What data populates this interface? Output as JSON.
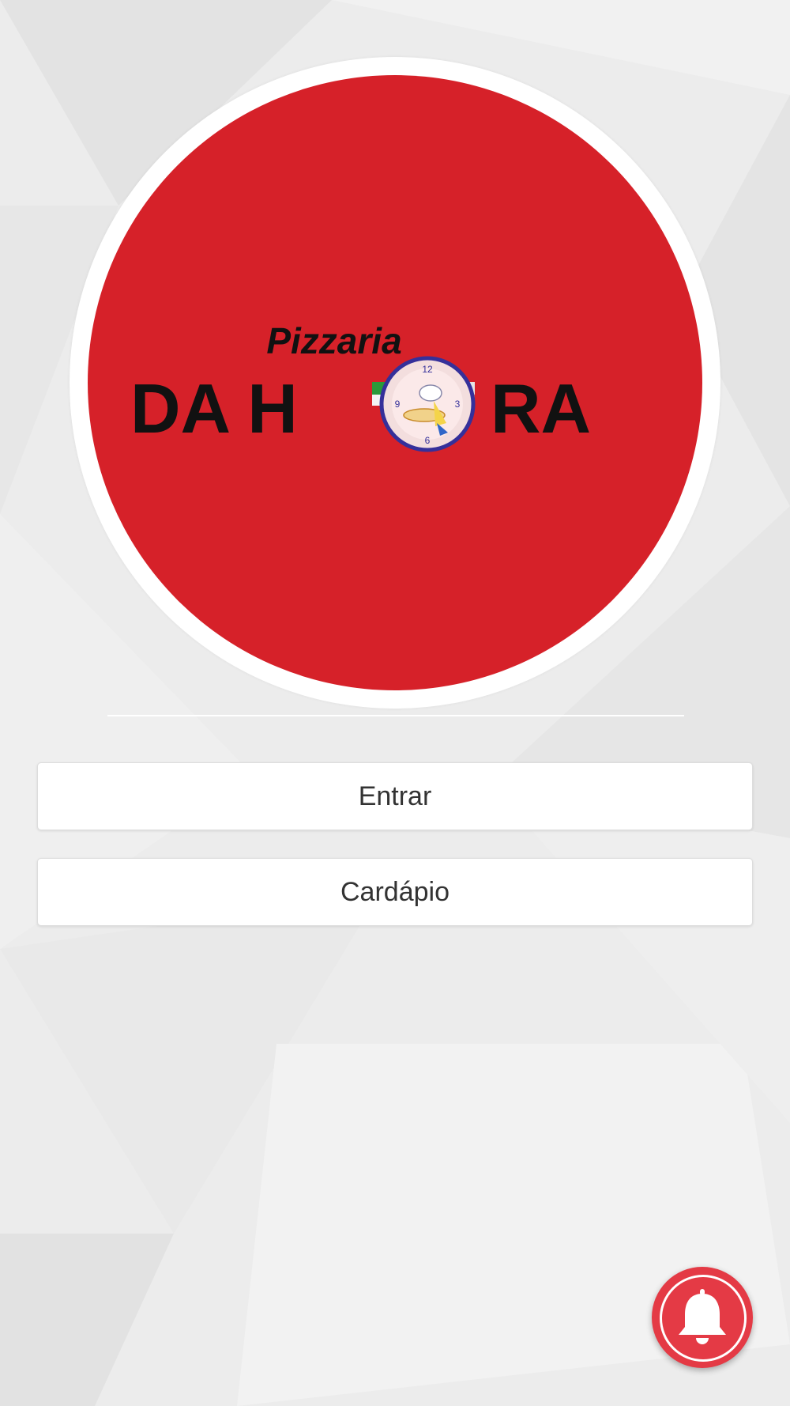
{
  "logo": {
    "script_text": "Pizzaria",
    "name_left": "DA H",
    "name_right": "RA",
    "brand_red": "#d62129"
  },
  "buttons": {
    "entrar": "Entrar",
    "cardapio": "Cardápio"
  },
  "notification_button": {
    "icon": "bell-icon",
    "color": "#e43a45"
  }
}
